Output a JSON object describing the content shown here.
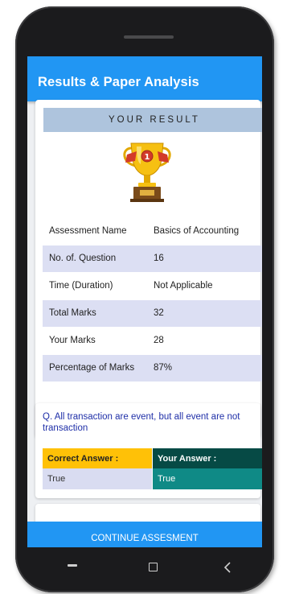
{
  "appbar": {
    "title": "Results & Paper Analysis"
  },
  "result": {
    "header": "YOUR RESULT",
    "trophy_badge": "1",
    "rows": [
      {
        "label": "Assessment Name",
        "value": "Basics of Accounting"
      },
      {
        "label": "No. of. Question",
        "value": "16"
      },
      {
        "label": "Time (Duration)",
        "value": "Not Applicable"
      },
      {
        "label": "Total Marks",
        "value": "32"
      },
      {
        "label": "Your Marks",
        "value": "28"
      },
      {
        "label": "Percentage of Marks",
        "value": "87%"
      }
    ]
  },
  "question_card": {
    "question": "Q. All transaction are event, but all event are not transaction",
    "correct_label": "Correct Answer :",
    "correct_value": "True",
    "your_label": "Your Answer :",
    "your_value": "True"
  },
  "footer": {
    "continue_label": "CONTINUE ASSESMENT"
  },
  "nav": {
    "back_icon": "back-icon",
    "home_icon": "home-icon",
    "recents_icon": "recents-icon"
  },
  "colors": {
    "primary": "#2196f3",
    "header_bg": "#aec4dd",
    "row_alt": "#dcdff3",
    "correct_head": "#ffc107",
    "correct_val": "#d9dcf1",
    "your_head": "#064a45",
    "your_val": "#0f8a86",
    "question_text": "#1f2fa8"
  }
}
